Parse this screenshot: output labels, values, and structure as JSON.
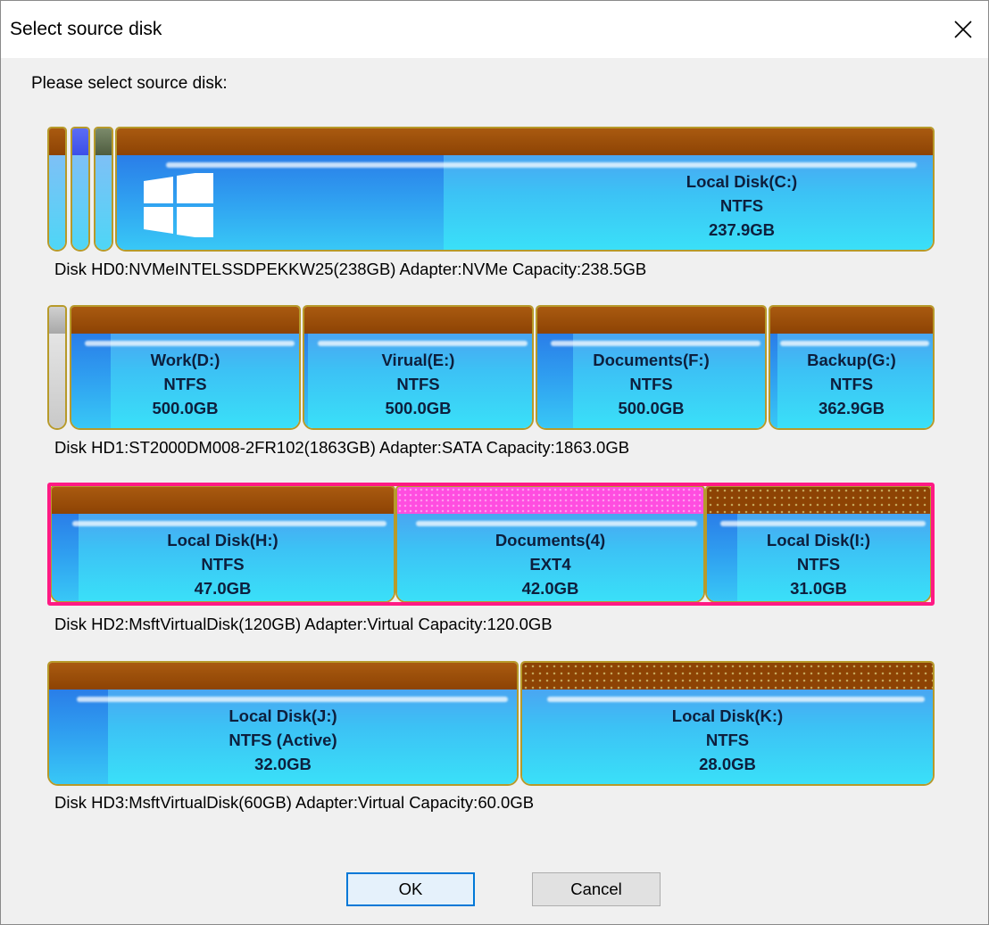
{
  "window": {
    "title": "Select source disk"
  },
  "prompt": "Please select source disk:",
  "disks": [
    {
      "label": "Disk HD0:NVMeINTELSSDPEKKW25(238GB)  Adapter:NVMe  Capacity:238.5GB",
      "partitions": [
        {
          "name": "Local Disk(C:)",
          "fs": "NTFS",
          "size": "237.9GB"
        }
      ]
    },
    {
      "label": "Disk HD1:ST2000DM008-2FR102(1863GB)  Adapter:SATA  Capacity:1863.0GB",
      "partitions": [
        {
          "name": "Work(D:)",
          "fs": "NTFS",
          "size": "500.0GB"
        },
        {
          "name": "Virual(E:)",
          "fs": "NTFS",
          "size": "500.0GB"
        },
        {
          "name": "Documents(F:)",
          "fs": "NTFS",
          "size": "500.0GB"
        },
        {
          "name": "Backup(G:)",
          "fs": "NTFS",
          "size": "362.9GB"
        }
      ]
    },
    {
      "label": "Disk HD2:MsftVirtualDisk(120GB)  Adapter:Virtual  Capacity:120.0GB",
      "selected": true,
      "partitions": [
        {
          "name": "Local Disk(H:)",
          "fs": "NTFS",
          "size": "47.0GB"
        },
        {
          "name": "Documents(4)",
          "fs": "EXT4",
          "size": "42.0GB"
        },
        {
          "name": "Local Disk(I:)",
          "fs": "NTFS",
          "size": "31.0GB"
        }
      ]
    },
    {
      "label": "Disk HD3:MsftVirtualDisk(60GB)  Adapter:Virtual  Capacity:60.0GB",
      "partitions": [
        {
          "name": "Local Disk(J:)",
          "fs": "NTFS (Active)",
          "size": "32.0GB"
        },
        {
          "name": "Local Disk(K:)",
          "fs": "NTFS",
          "size": "28.0GB"
        }
      ]
    }
  ],
  "buttons": {
    "ok": "OK",
    "cancel": "Cancel"
  },
  "colors": {
    "band": "#8d4304",
    "selection": "#ff1a84",
    "partition_fill": "#3ae0f8",
    "used_fill": "#2a7ee8"
  },
  "icons": {
    "close": "close-icon",
    "os": "windows-logo-icon"
  }
}
